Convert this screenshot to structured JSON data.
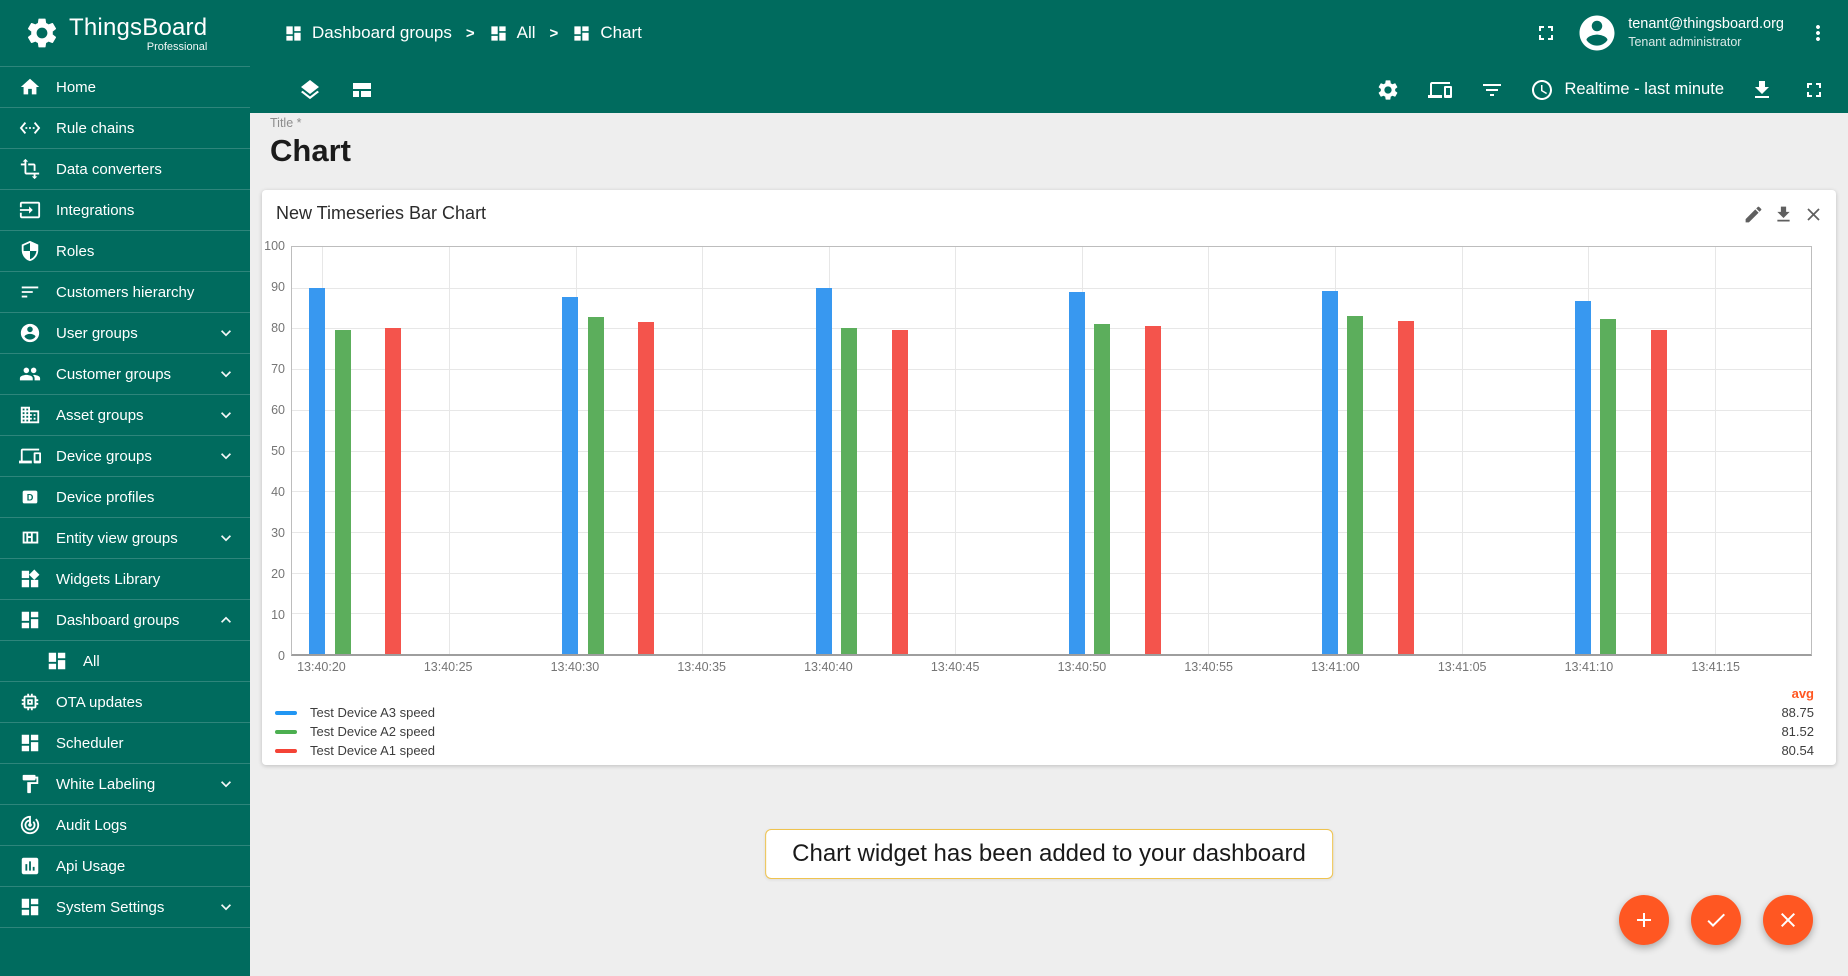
{
  "theme": {
    "primary": "#006B5E",
    "content_bg": "#EEEEEE",
    "accent": "#FF5722",
    "toast_border": "#EFC34F"
  },
  "brand": {
    "name": "ThingsBoard",
    "edition": "Professional"
  },
  "header": {
    "breadcrumbs": [
      {
        "label": "Dashboard groups",
        "icon": "dashboard-icon"
      },
      {
        "label": "All",
        "icon": "dashboard-icon"
      },
      {
        "label": "Chart",
        "icon": "dashboard-icon"
      }
    ],
    "separator": ">",
    "user_email": "tenant@thingsboard.org",
    "user_role": "Tenant administrator"
  },
  "toolbar": {
    "timewindow_label": "Realtime - last minute"
  },
  "sidebar": {
    "items": [
      {
        "label": "Home",
        "icon": "home-icon"
      },
      {
        "label": "Rule chains",
        "icon": "rule-chains-icon"
      },
      {
        "label": "Data converters",
        "icon": "data-converters-icon"
      },
      {
        "label": "Integrations",
        "icon": "integrations-icon"
      },
      {
        "label": "Roles",
        "icon": "roles-icon"
      },
      {
        "label": "Customers hierarchy",
        "icon": "customers-hierarchy-icon"
      },
      {
        "label": "User groups",
        "icon": "user-groups-icon",
        "chevron": "down"
      },
      {
        "label": "Customer groups",
        "icon": "customer-groups-icon",
        "chevron": "down"
      },
      {
        "label": "Asset groups",
        "icon": "asset-groups-icon",
        "chevron": "down"
      },
      {
        "label": "Device groups",
        "icon": "device-groups-icon",
        "chevron": "down"
      },
      {
        "label": "Device profiles",
        "icon": "device-profiles-icon"
      },
      {
        "label": "Entity view groups",
        "icon": "entity-view-groups-icon",
        "chevron": "down"
      },
      {
        "label": "Widgets Library",
        "icon": "widgets-library-icon"
      },
      {
        "label": "Dashboard groups",
        "icon": "dashboard-icon",
        "chevron": "up"
      },
      {
        "label": "All",
        "icon": "dashboard-icon",
        "sub": true
      },
      {
        "label": "OTA updates",
        "icon": "ota-updates-icon"
      },
      {
        "label": "Scheduler",
        "icon": "scheduler-icon"
      },
      {
        "label": "White Labeling",
        "icon": "white-labeling-icon",
        "chevron": "down"
      },
      {
        "label": "Audit Logs",
        "icon": "audit-logs-icon"
      },
      {
        "label": "Api Usage",
        "icon": "api-usage-icon"
      },
      {
        "label": "System Settings",
        "icon": "system-settings-icon",
        "chevron": "down"
      }
    ]
  },
  "page": {
    "title_field_label": "Title *",
    "title_value": "Chart"
  },
  "widget": {
    "title": "New Timeseries Bar Chart"
  },
  "legend": {
    "avg_header": "avg"
  },
  "toast": {
    "message": "Chart widget has been added to your dashboard"
  },
  "chart_data": {
    "type": "bar",
    "title": "New Timeseries Bar Chart",
    "ylabel": "",
    "xlabel": "",
    "ylim": [
      0,
      100
    ],
    "y_tick_step": 10,
    "grid": true,
    "legend_position": "bottom",
    "x_window_seconds": 60,
    "bar_width_seconds": 0.65,
    "x_ticks": [
      {
        "offset_s": 1.2,
        "label": "13:40:20"
      },
      {
        "offset_s": 6.2,
        "label": "13:40:25"
      },
      {
        "offset_s": 11.2,
        "label": "13:40:30"
      },
      {
        "offset_s": 16.2,
        "label": "13:40:35"
      },
      {
        "offset_s": 21.2,
        "label": "13:40:40"
      },
      {
        "offset_s": 26.2,
        "label": "13:40:45"
      },
      {
        "offset_s": 31.2,
        "label": "13:40:50"
      },
      {
        "offset_s": 36.2,
        "label": "13:40:55"
      },
      {
        "offset_s": 41.2,
        "label": "13:41:00"
      },
      {
        "offset_s": 46.2,
        "label": "13:41:05"
      },
      {
        "offset_s": 51.2,
        "label": "13:41:10"
      },
      {
        "offset_s": 56.2,
        "label": "13:41:15"
      }
    ],
    "series": [
      {
        "name": "Test Device A3 speed",
        "color": "#3898F0",
        "legend_color": "#2196F3",
        "avg": "88.75",
        "points": [
          [
            1.0,
            90.0
          ],
          [
            11.0,
            87.6
          ],
          [
            21.0,
            90.0
          ],
          [
            31.0,
            89.0
          ],
          [
            41.0,
            89.2
          ],
          [
            51.0,
            86.7
          ]
        ]
      },
      {
        "name": "Test Device A2 speed",
        "color": "#5CAE5C",
        "legend_color": "#4CAF50",
        "avg": "81.52",
        "points": [
          [
            2.0,
            79.6
          ],
          [
            12.0,
            82.7
          ],
          [
            22.0,
            80.2
          ],
          [
            32.0,
            81.2
          ],
          [
            42.0,
            83.0
          ],
          [
            52.0,
            82.4
          ]
        ]
      },
      {
        "name": "Test Device A1 speed",
        "color": "#F4544C",
        "legend_color": "#F44336",
        "avg": "80.54",
        "points": [
          [
            4.0,
            80.0
          ],
          [
            14.0,
            81.6
          ],
          [
            24.0,
            79.5
          ],
          [
            34.0,
            80.7
          ],
          [
            44.0,
            81.8
          ],
          [
            54.0,
            79.6
          ]
        ]
      }
    ]
  }
}
